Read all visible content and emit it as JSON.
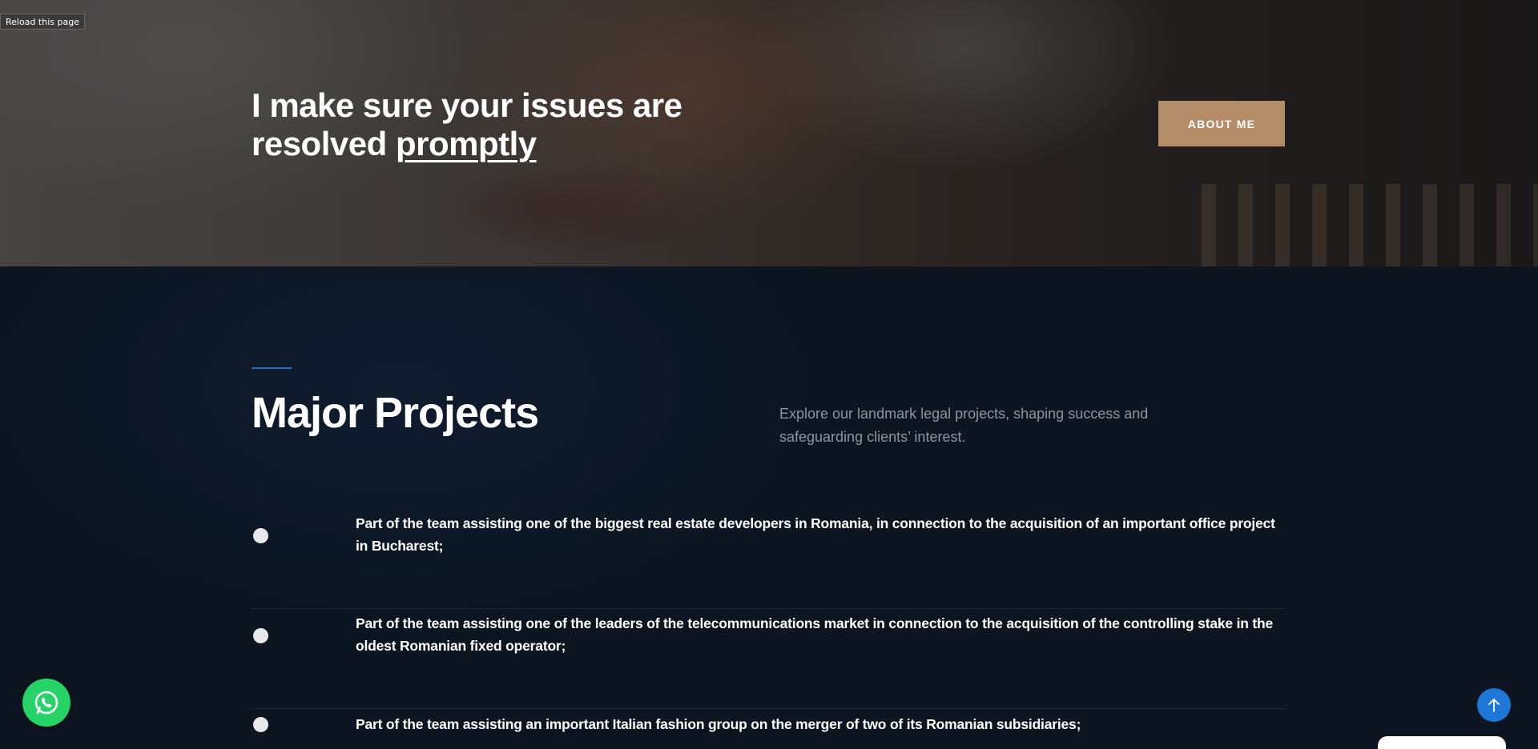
{
  "browser": {
    "reload_tooltip": "Reload this page"
  },
  "hero": {
    "heading_line1": "I make sure your issues are",
    "heading_line2_prefix": "resolved ",
    "heading_emphasis": "promptly",
    "about_button_label": "ABOUT ME"
  },
  "projects": {
    "title": "Major Projects",
    "description": "Explore our landmark legal projects, shaping success and safeguarding clients’ interest.",
    "items": [
      {
        "text": "Part of the team assisting one of the biggest real estate developers in Romania, in connection to the acquisition of an important office project in Bucharest;"
      },
      {
        "text": "Part of the team assisting one of the leaders of the telecommunications market in connection to the acquisition of the controlling stake in the oldest Romanian fixed operator;"
      },
      {
        "text": "Part of the team assisting an important Italian fashion group on the merger of two of its Romanian subsidiaries;"
      }
    ]
  },
  "floating": {
    "whatsapp_icon": "whatsapp-icon",
    "scroll_top_icon": "arrow-up-icon"
  },
  "colors": {
    "accent_button": "#b48c68",
    "accent_line": "#1e6fc9",
    "whatsapp": "#25d366",
    "scroll_top": "#1e77d6",
    "section_bg": "#0d1624"
  }
}
